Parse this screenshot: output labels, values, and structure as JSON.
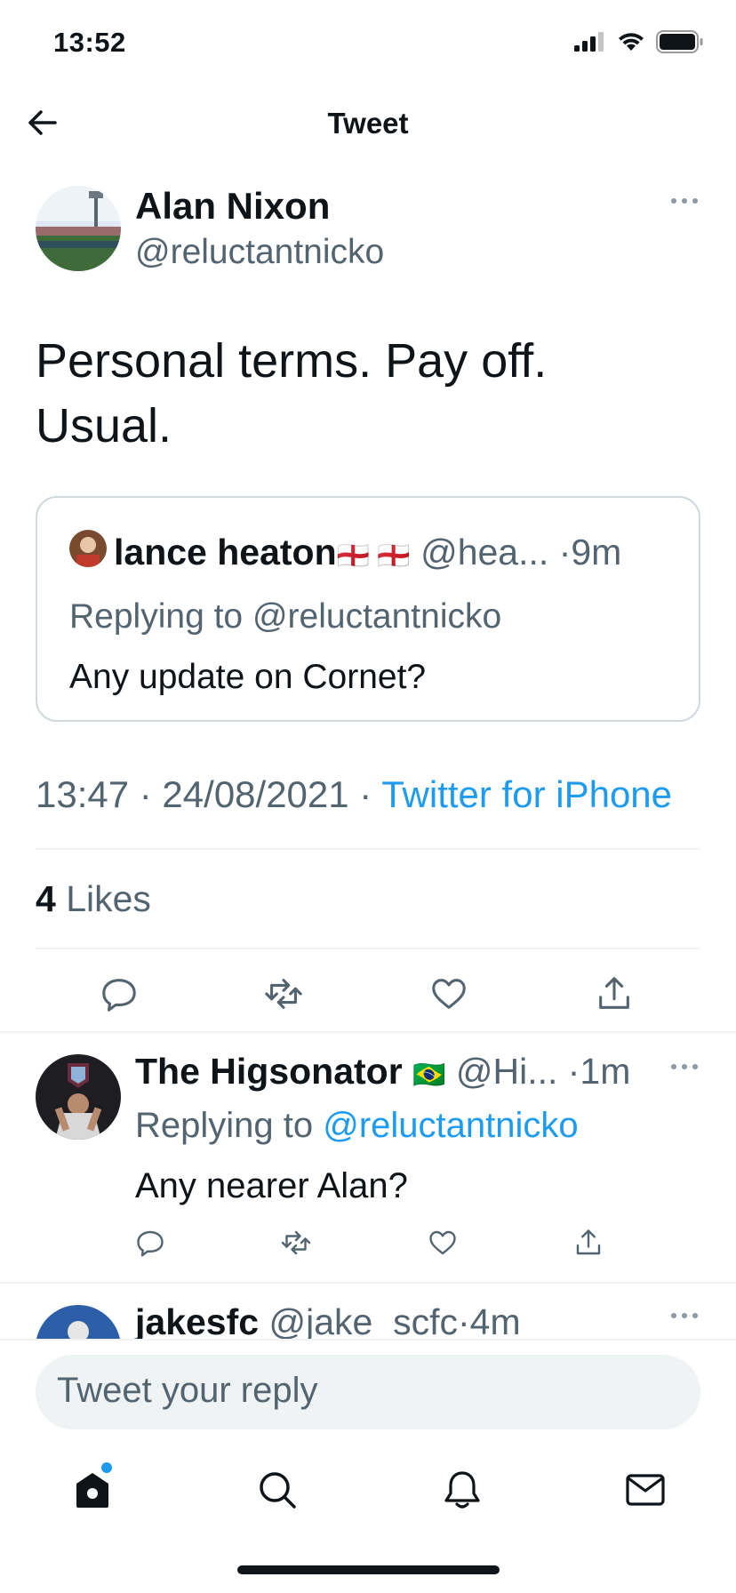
{
  "status_bar": {
    "time": "13:52"
  },
  "nav": {
    "title": "Tweet"
  },
  "tweet": {
    "author_name": "Alan Nixon",
    "author_handle": "@reluctantnicko",
    "text_line1": "Personal terms. Pay off.",
    "text_line2": "Usual.",
    "quote": {
      "name": "lance heaton",
      "flags": "🏴󠁧󠁢󠁥󠁮󠁧󠁿 🏴󠁧󠁢󠁥󠁮󠁧󠁿",
      "handle": "@hea...",
      "time": "·9m",
      "replying_to": "Replying to @reluctantnicko",
      "text": "Any update on Cornet?"
    },
    "timestamp": "13:47 · 24/08/2021 · ",
    "source": "Twitter for iPhone",
    "likes_count": "4",
    "likes_label": "Likes"
  },
  "replies": [
    {
      "name": "The Higsonator",
      "flag": "🇧🇷",
      "handle": "@Hi...",
      "time": "·1m",
      "replying_prefix": "Replying to ",
      "replying_handle": "@reluctantnicko",
      "text": "Any nearer Alan?"
    },
    {
      "name": "jakesfc",
      "handle": "@jake_scfc",
      "time": "·4m"
    }
  ],
  "composer": {
    "placeholder": "Tweet your reply"
  },
  "icons": {
    "back": "arrow-left-icon",
    "more": "more-horizontal-icon",
    "reply": "comment-icon",
    "retweet": "retweet-icon",
    "like": "heart-icon",
    "share": "share-icon",
    "tabs": [
      "home-icon",
      "search-icon",
      "bell-icon",
      "mail-icon"
    ]
  },
  "colors": {
    "accent": "#1d9bf0",
    "secondary_text": "#536471",
    "divider": "#eff3f4"
  }
}
